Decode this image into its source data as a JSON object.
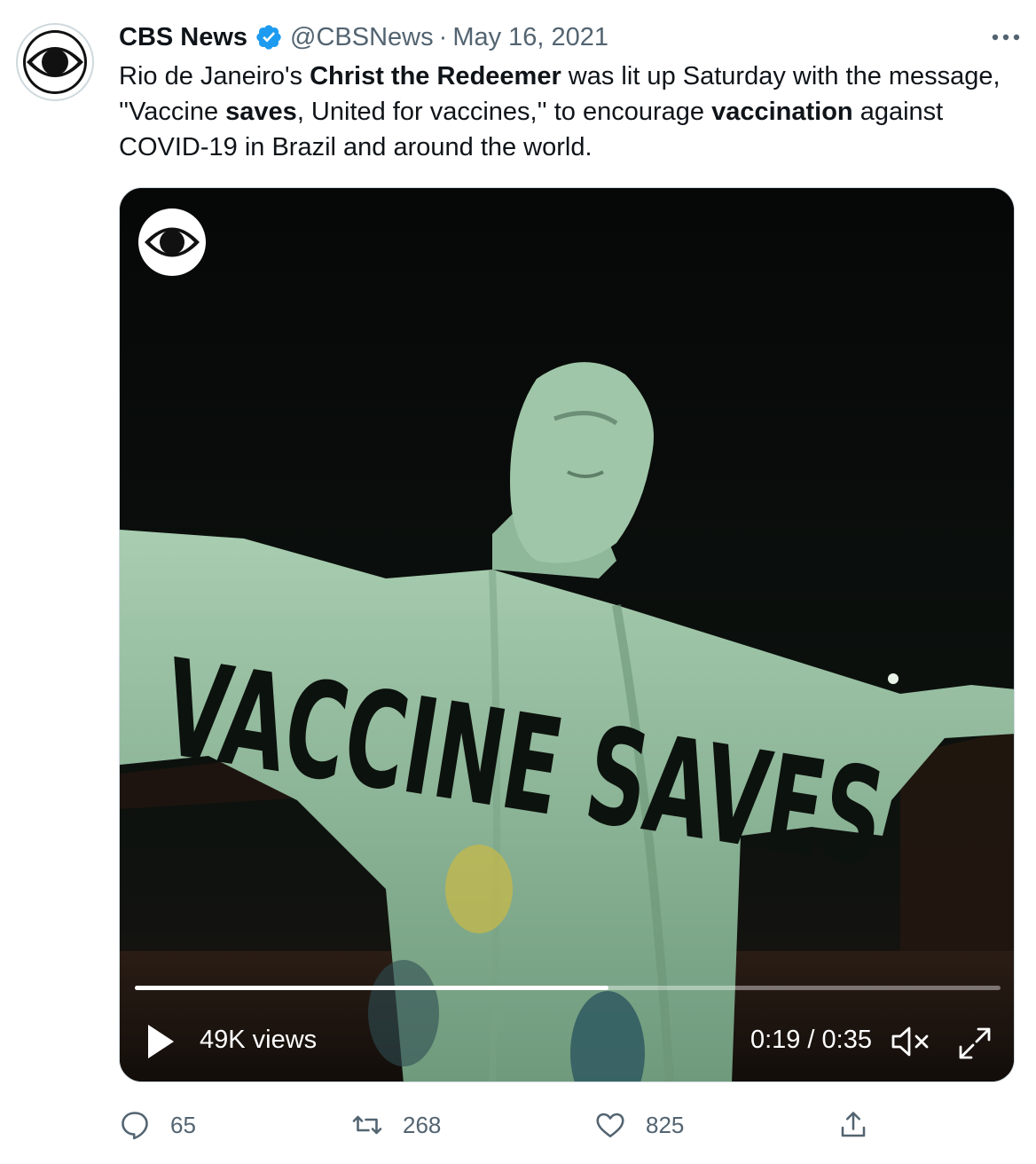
{
  "tweet": {
    "author_name": "CBS News",
    "handle": "@CBSNews",
    "separator": "·",
    "date": "May 16, 2021",
    "text_segments": [
      {
        "text": "Rio de Janeiro's ",
        "bold": false
      },
      {
        "text": "Christ the Redeemer",
        "bold": true
      },
      {
        "text": " was lit up Saturday with the message, ''Vaccine ",
        "bold": false
      },
      {
        "text": "saves",
        "bold": true
      },
      {
        "text": ", United for vaccines,'' to encourage ",
        "bold": false
      },
      {
        "text": "vaccination",
        "bold": true
      },
      {
        "text": " against COVID-19 in Brazil and around the world.",
        "bold": false
      }
    ]
  },
  "video": {
    "overlay_text": "VACCINE SAVES",
    "views_label": "49K views",
    "time_label": "0:19 / 0:35",
    "progress": 0.547
  },
  "actions": {
    "replies": "65",
    "retweets": "268",
    "likes": "825"
  },
  "icons": {
    "verified": "verified-badge-icon",
    "more": "more-dots-icon",
    "play": "play-icon",
    "mute": "muted-speaker-icon",
    "fullscreen": "expand-icon",
    "reply": "reply-bubble-icon",
    "retweet": "retweet-icon",
    "like": "heart-icon",
    "share": "share-icon"
  },
  "colors": {
    "verified_blue": "#1d9bf0",
    "secondary_text": "#536471",
    "statue_green": "#9bc4a6"
  }
}
